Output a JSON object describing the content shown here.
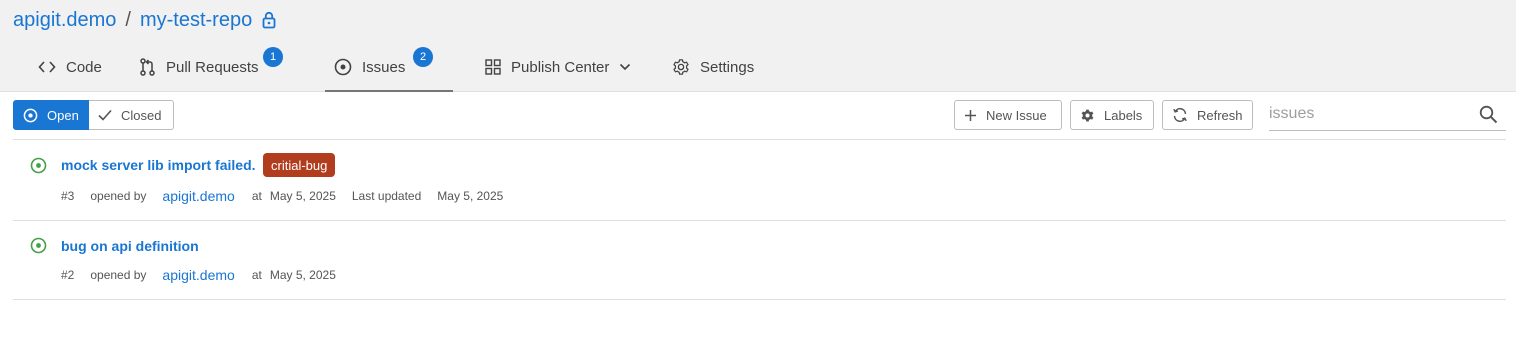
{
  "breadcrumb": {
    "owner": "apigit.demo",
    "separator": "/",
    "repo": "my-test-repo"
  },
  "tabs": [
    {
      "label": "Code",
      "icon": "code-icon"
    },
    {
      "label": "Pull Requests",
      "icon": "pull-request-icon",
      "badge": "1"
    },
    {
      "label": "Issues",
      "icon": "issue-open-icon",
      "badge": "2",
      "active": true
    },
    {
      "label": "Publish Center",
      "icon": "grid-icon",
      "dropdown": true
    },
    {
      "label": "Settings",
      "icon": "gear-icon"
    }
  ],
  "filters": {
    "open_label": "Open",
    "closed_label": "Closed",
    "selected": "Open"
  },
  "actions": {
    "new_issue_label": "New Issue",
    "labels_label": "Labels",
    "refresh_label": "Refresh"
  },
  "search": {
    "placeholder": "issues",
    "value": ""
  },
  "issues": [
    {
      "title": "mock server lib import failed.",
      "label": "critial-bug",
      "number": "#3",
      "opened_by_text": "opened by",
      "author": "apigit.demo",
      "at_text": "at",
      "opened_date": "May 5, 2025",
      "last_updated_text": "Last updated",
      "updated_date": "May 5, 2025",
      "status": "open"
    },
    {
      "title": "bug on api definition",
      "number": "#2",
      "opened_by_text": "opened by",
      "author": "apigit.demo",
      "at_text": "at",
      "opened_date": "May 5, 2025",
      "status": "open"
    }
  ],
  "colors": {
    "accent": "#1976d2",
    "open_status": "#43a047",
    "label_bug": "#b23c1e",
    "header_bg": "#f1f1f1"
  }
}
